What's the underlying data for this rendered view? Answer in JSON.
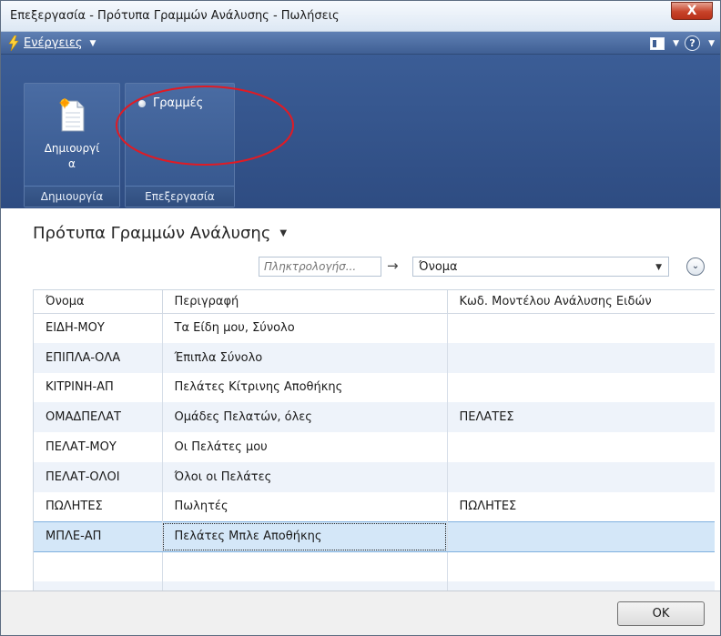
{
  "window": {
    "title": "Επεξεργασία - Πρότυπα Γραμμών Ανάλυσης - Πωλήσεις",
    "close_label": "X"
  },
  "actions_bar": {
    "menu_label": "Ενέργειες",
    "help_label": "?"
  },
  "ribbon": {
    "groups": [
      {
        "caption": "Δημιουργία",
        "button_label_line1": "Δημιουργί",
        "button_label_line2": "α"
      },
      {
        "caption": "Επεξεργασία",
        "button_label": "Γραμμές"
      }
    ],
    "annotation_color": "#e01b24"
  },
  "page": {
    "title": "Πρότυπα Γραμμών Ανάλυσης"
  },
  "filter": {
    "search_placeholder": "Πληκτρολογήσ...",
    "field_value": "Όνομα"
  },
  "table": {
    "columns": [
      "Όνομα",
      "Περιγραφή",
      "Κωδ. Μοντέλου Ανάλυσης Ειδών"
    ],
    "rows": [
      [
        "ΕΙΔΗ-ΜΟΥ",
        "Τα Είδη μου, Σύνολο",
        ""
      ],
      [
        "ΕΠΙΠΛΑ-ΟΛΑ",
        "Έπιπλα Σύνολο",
        ""
      ],
      [
        "ΚΙΤΡΙΝΗ-ΑΠ",
        "Πελάτες Κίτρινης Αποθήκης",
        ""
      ],
      [
        "ΟΜΑΔΠΕΛΑΤ",
        "Ομάδες Πελατών, όλες",
        "ΠΕΛΑΤΕΣ"
      ],
      [
        "ΠΕΛΑΤ-ΜΟΥ",
        "Οι Πελάτες μου",
        ""
      ],
      [
        "ΠΕΛΑΤ-ΟΛΟΙ",
        "Όλοι οι Πελάτες",
        ""
      ],
      [
        "ΠΩΛΗΤΕΣ",
        "Πωλητές",
        "ΠΩΛΗΤΕΣ"
      ],
      [
        "ΜΠΛΕ-ΑΠ",
        "Πελάτες Μπλε Αποθήκης",
        ""
      ]
    ],
    "selected_row": 7
  },
  "footer": {
    "ok_label": "OK"
  }
}
